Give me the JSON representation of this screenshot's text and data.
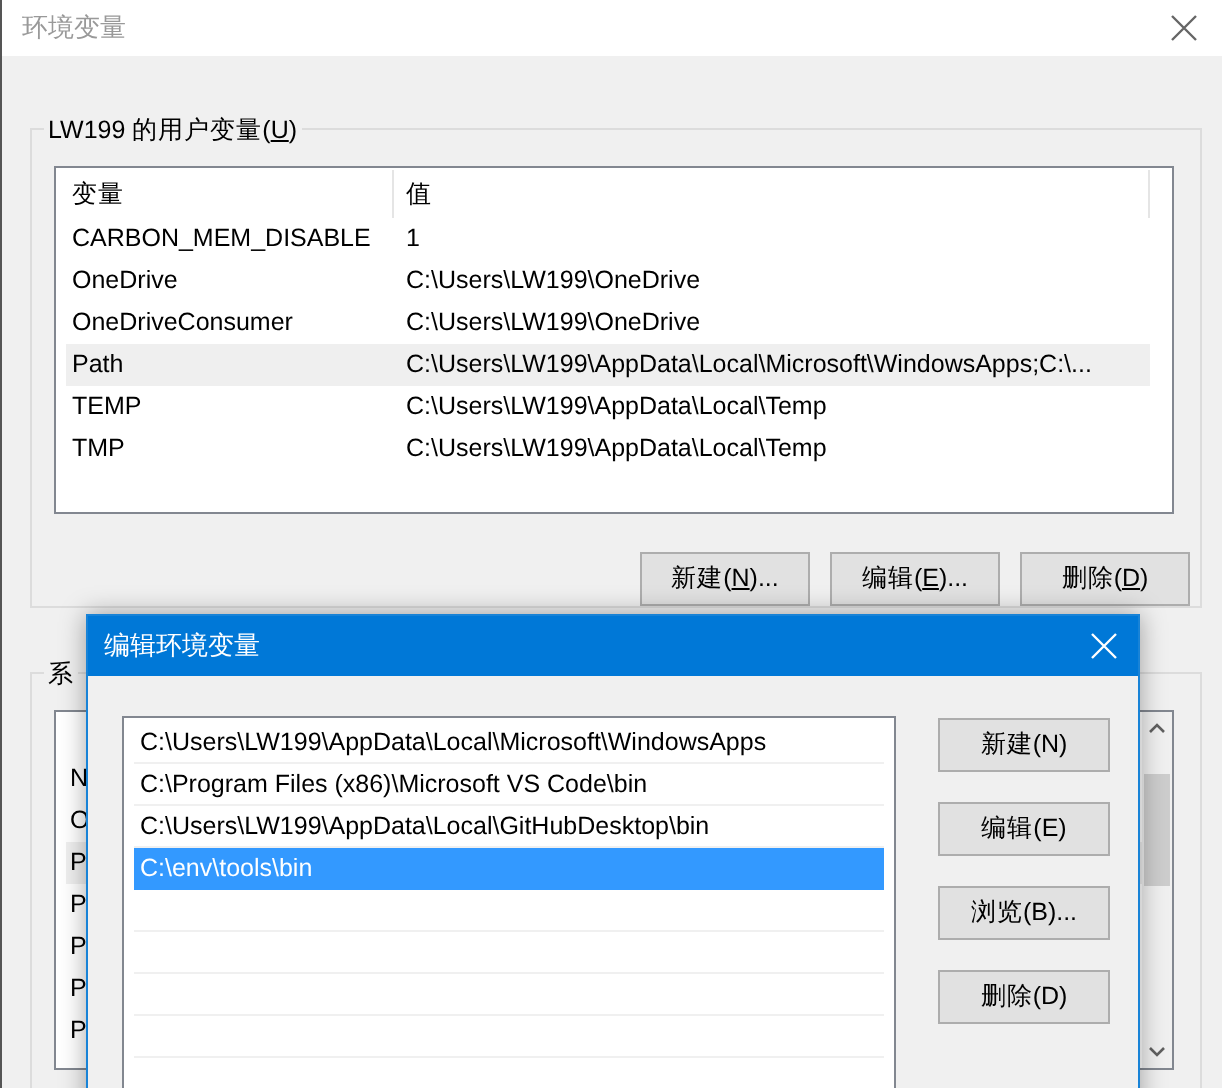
{
  "window": {
    "title": "环境变量"
  },
  "user_vars": {
    "label": {
      "before": "LW199 的用户变量(",
      "accel": "U",
      "after": ")"
    },
    "columns": [
      "变量",
      "值"
    ],
    "rows": [
      {
        "name": "CARBON_MEM_DISABLE",
        "value": "1",
        "selected": false
      },
      {
        "name": "OneDrive",
        "value": "C:\\Users\\LW199\\OneDrive",
        "selected": false
      },
      {
        "name": "OneDriveConsumer",
        "value": "C:\\Users\\LW199\\OneDrive",
        "selected": false
      },
      {
        "name": "Path",
        "value": "C:\\Users\\LW199\\AppData\\Local\\Microsoft\\WindowsApps;C:\\...",
        "selected": true
      },
      {
        "name": "TEMP",
        "value": "C:\\Users\\LW199\\AppData\\Local\\Temp",
        "selected": false
      },
      {
        "name": "TMP",
        "value": "C:\\Users\\LW199\\AppData\\Local\\Temp",
        "selected": false
      }
    ],
    "buttons": [
      {
        "before": "新建(",
        "accel": "N",
        "after": ")..."
      },
      {
        "before": "编辑(",
        "accel": "E",
        "after": ")..."
      },
      {
        "before": "删除(",
        "accel": "D",
        "after": ")"
      }
    ]
  },
  "system_vars": {
    "label": "系",
    "rows": [
      {
        "text": "N",
        "selected": false
      },
      {
        "text": "O",
        "selected": false
      },
      {
        "text": "P",
        "selected": true
      },
      {
        "text": "P",
        "selected": false
      },
      {
        "text": "P",
        "selected": false
      },
      {
        "text": "P",
        "selected": false
      },
      {
        "text": "P",
        "selected": false
      }
    ]
  },
  "dialog": {
    "title": "编辑环境变量",
    "paths": [
      {
        "text": "C:\\Users\\LW199\\AppData\\Local\\Microsoft\\WindowsApps",
        "selected": false
      },
      {
        "text": "C:\\Program Files (x86)\\Microsoft VS Code\\bin",
        "selected": false
      },
      {
        "text": "C:\\Users\\LW199\\AppData\\Local\\GitHubDesktop\\bin",
        "selected": false
      },
      {
        "text": "C:\\env\\tools\\bin",
        "selected": true
      }
    ],
    "buttons": [
      "新建(N)",
      "编辑(E)",
      "浏览(B)...",
      "删除(D)"
    ]
  }
}
